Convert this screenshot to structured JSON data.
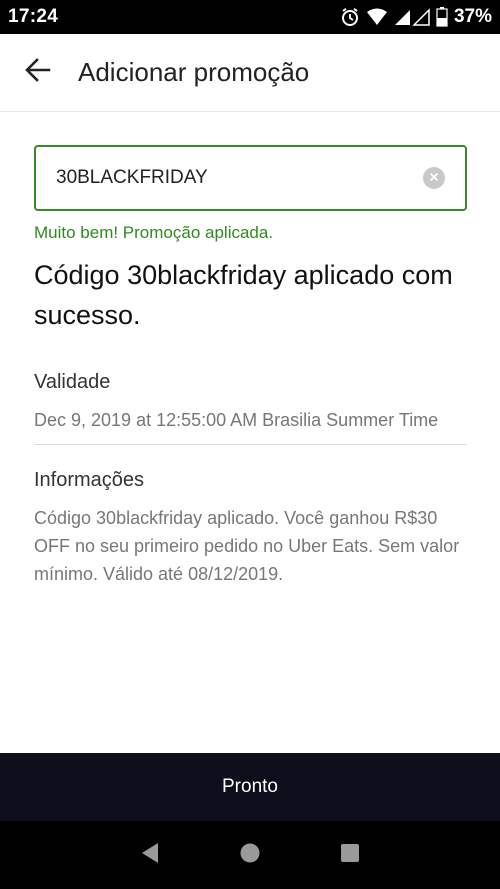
{
  "status_bar": {
    "time": "17:24",
    "battery": "37%"
  },
  "app_bar": {
    "title": "Adicionar promoção"
  },
  "promo": {
    "input_value": "30BLACKFRIDAY",
    "success_message": "Muito bem! Promoção aplicada.",
    "headline": "Código 30blackfriday aplicado com sucesso."
  },
  "validity": {
    "label": "Validade",
    "text": "Dec 9, 2019 at 12:55:00 AM Brasilia Summer Time"
  },
  "info": {
    "label": "Informações",
    "text": "Código 30blackfriday aplicado. Você ganhou R$30 OFF no seu primeiro pedido no Uber Eats. Sem valor mínimo. Válido até 08/12/2019."
  },
  "actions": {
    "done_label": "Pronto"
  },
  "colors": {
    "success_green": "#2f8a1f",
    "input_border": "#3a8a2c",
    "done_bar": "#0d0d1c"
  },
  "icons": {
    "back": "arrow-left-icon",
    "clear": "clear-circle-icon",
    "alarm": "alarm-icon",
    "wifi": "wifi-icon",
    "signal": "signal-icon",
    "battery": "battery-icon",
    "nav_back": "nav-back-icon",
    "nav_home": "nav-home-icon",
    "nav_recents": "nav-recents-icon"
  }
}
